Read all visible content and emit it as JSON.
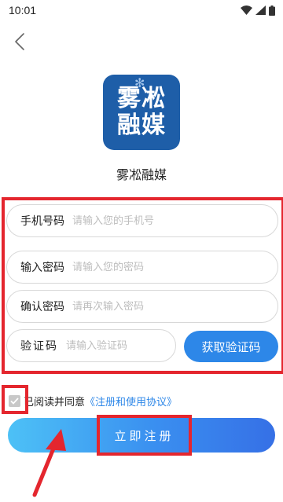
{
  "status_bar": {
    "time": "10:01",
    "icons": [
      "wifi-icon",
      "signal-icon",
      "battery-icon"
    ]
  },
  "header": {
    "back_icon": "chevron-left-icon"
  },
  "app": {
    "logo_text": "雾凇融媒",
    "name": "雾凇融媒"
  },
  "form": {
    "phone": {
      "label": "手机号码",
      "placeholder": "请输入您的手机号"
    },
    "password": {
      "label": "输入密码",
      "placeholder": "请输入您的密码"
    },
    "confirm": {
      "label": "确认密码",
      "placeholder": "请再次输入密码"
    },
    "code": {
      "label": "验证码",
      "placeholder": "请输入验证码"
    },
    "get_code_label": "获取验证码"
  },
  "agreement": {
    "prefix": "已阅读并同意",
    "link": "《注册和使用协议》",
    "checked": true
  },
  "submit_label": "立即注册",
  "colors": {
    "primary": "#2d87e8",
    "highlight": "#e4262e",
    "logo_bg": "#1e5ea8"
  }
}
